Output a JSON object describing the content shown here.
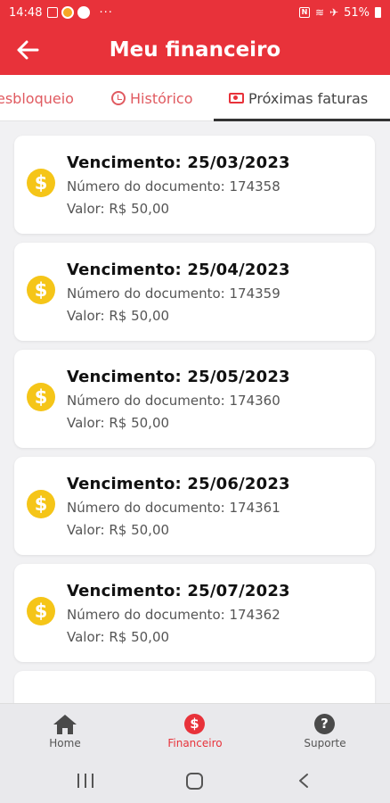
{
  "status_bar": {
    "time": "14:48",
    "battery": "51%"
  },
  "app_bar": {
    "title": "Meu financeiro",
    "back_icon": "arrow-left-icon"
  },
  "tabs": [
    {
      "label": "esbloqueio",
      "icon": "",
      "active": false
    },
    {
      "label": "Histórico",
      "icon": "clock-icon",
      "active": false
    },
    {
      "label": "Próximas faturas",
      "icon": "bill-icon",
      "active": true
    }
  ],
  "invoices": [
    {
      "due": "Vencimento: 25/03/2023",
      "document": "Número do documento: 174358",
      "value": "Valor: R$ 50,00"
    },
    {
      "due": "Vencimento: 25/04/2023",
      "document": "Número do documento: 174359",
      "value": "Valor: R$ 50,00"
    },
    {
      "due": "Vencimento: 25/05/2023",
      "document": "Número do documento: 174360",
      "value": "Valor: R$ 50,00"
    },
    {
      "due": "Vencimento: 25/06/2023",
      "document": "Número do documento: 174361",
      "value": "Valor: R$ 50,00"
    },
    {
      "due": "Vencimento: 25/07/2023",
      "document": "Número do documento: 174362",
      "value": "Valor: R$ 50,00"
    }
  ],
  "bottom_nav": [
    {
      "label": "Home",
      "icon": "home-icon",
      "active": false
    },
    {
      "label": "Financeiro",
      "icon": "dollar-icon",
      "active": true
    },
    {
      "label": "Suporte",
      "icon": "help-icon",
      "active": false
    }
  ],
  "colors": {
    "primary": "#e8323a",
    "coin": "#f5c518",
    "background": "#f1f1f3"
  }
}
